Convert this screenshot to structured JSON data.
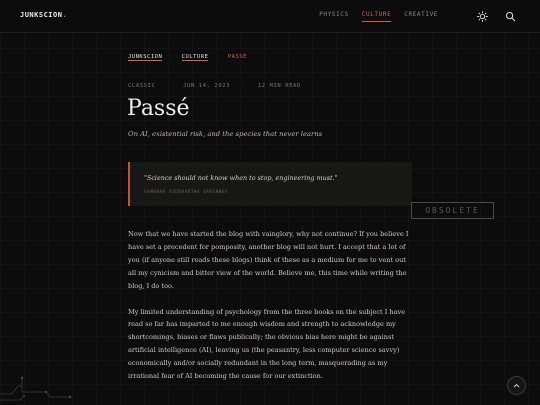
{
  "header": {
    "logo": "JUNKSCION",
    "logo_dot": ".",
    "nav": [
      "PHYSICS",
      "CULTURE",
      "CREATIVE"
    ],
    "active_nav": "CULTURE",
    "icons": [
      "sun-icon",
      "search-icon"
    ]
  },
  "breadcrumb": {
    "home": "JUNKSCION",
    "section": "CULTURE",
    "current": "PASSÉ",
    "separator": "·"
  },
  "meta": {
    "category": "CLASSIC",
    "date": "JUN 14, 2023",
    "read_time": "12 MIN READ",
    "separator": "·"
  },
  "article": {
    "title": "Passé",
    "subtitle": "On AI, existential risk, and the species that never learns",
    "quote": "\"Science should not know when to stop, engineering must.\"",
    "quote_author": "SAMBHAV SIDDHARTHA VARSHNEY",
    "stamp": "OBSOLETE",
    "paragraphs": [
      "Now that we have started the blog with vainglory, why not continue? If you believe I have set a precedent for pomposity, another blog will not hurt. I accept that a lot of you (if anyone still reads these blogs) think of these as a medium for me to vent out all my cynicism and bitter view of the world. Believe me, this time while writing the blog, I do too.",
      "My limited understanding of psychology from the three books on the subject I have read so far has imparted to me enough wisdom and strength to acknowledge my shortcomings, biases or flaws publically; the obvious bias here might be against artificial intelligence (AI), leaving us (the peasantry, less computer science savvy) economically and/or socially redundant in the long term, masquerading as my irrational fear of AI becoming the cause for our extinction."
    ]
  },
  "colors": {
    "background": "#0c0c0c",
    "accent": "#d0624c",
    "text": "#d8d4cc"
  },
  "back_to_top_icon": "chevron-up-icon"
}
